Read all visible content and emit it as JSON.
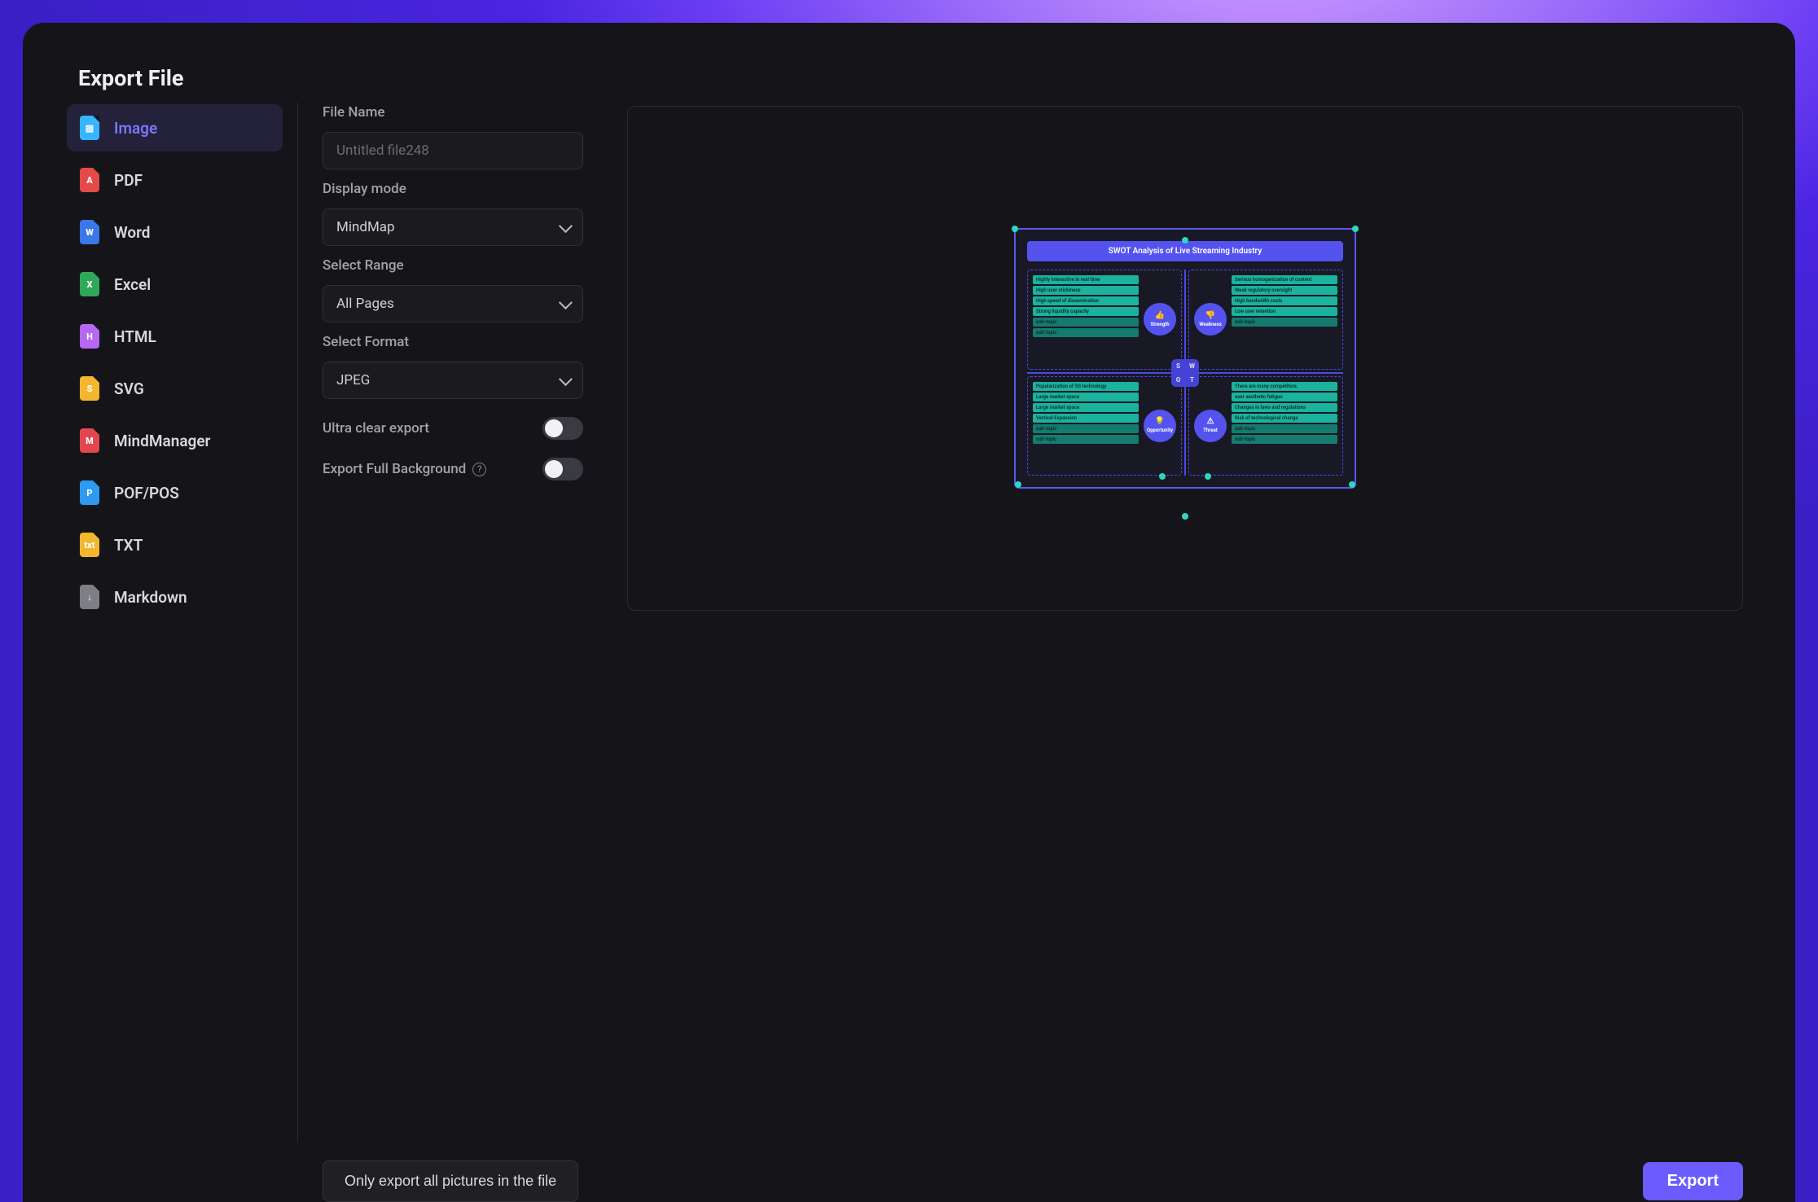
{
  "title": "Export File",
  "sidebar": [
    {
      "id": "image",
      "label": "Image",
      "glyph": "▨",
      "cls": "ic-img",
      "active": true
    },
    {
      "id": "pdf",
      "label": "PDF",
      "glyph": "A",
      "cls": "ic-pdf",
      "active": false
    },
    {
      "id": "word",
      "label": "Word",
      "glyph": "W",
      "cls": "ic-word",
      "active": false
    },
    {
      "id": "excel",
      "label": "Excel",
      "glyph": "X",
      "cls": "ic-xls",
      "active": false
    },
    {
      "id": "html",
      "label": "HTML",
      "glyph": "H",
      "cls": "ic-html",
      "active": false
    },
    {
      "id": "svg",
      "label": "SVG",
      "glyph": "S",
      "cls": "ic-svg",
      "active": false
    },
    {
      "id": "mindmanager",
      "label": "MindManager",
      "glyph": "M",
      "cls": "ic-mm",
      "active": false
    },
    {
      "id": "pofpos",
      "label": "POF/POS",
      "glyph": "P",
      "cls": "ic-pof",
      "active": false
    },
    {
      "id": "txt",
      "label": "TXT",
      "glyph": "txt",
      "cls": "ic-txt",
      "active": false
    },
    {
      "id": "markdown",
      "label": "Markdown",
      "glyph": "↓",
      "cls": "ic-md",
      "active": false
    }
  ],
  "form": {
    "filename_label": "File Name",
    "filename_placeholder": "Untitled file248",
    "filename_value": "",
    "display_mode_label": "Display mode",
    "display_mode_value": "MindMap",
    "select_range_label": "Select Range",
    "select_range_value": "All Pages",
    "select_format_label": "Select Format",
    "select_format_value": "JPEG",
    "ultra_clear_label": "Ultra clear export",
    "ultra_clear_on": false,
    "export_bg_label": "Export Full Background",
    "export_bg_on": false
  },
  "preview": {
    "title": "SWOT Analysis of Live Streaming Industry",
    "swot_letters": [
      "S",
      "W",
      "O",
      "T"
    ],
    "quadrants": {
      "strength": {
        "name": "Strength",
        "emoji": "👍",
        "items": [
          "Highly interactive in real time",
          "High user stickiness",
          "High speed of dissemination",
          "Strong liquidity capacity",
          "sub-topic",
          "sub-topic"
        ]
      },
      "weakness": {
        "name": "Weakness",
        "emoji": "👎",
        "items": [
          "Serious homogenization of content",
          "Weak regulatory oversight",
          "High bandwidth costs",
          "Low user retention",
          "sub-topic"
        ]
      },
      "opportunity": {
        "name": "Opportunity",
        "emoji": "💡",
        "items": [
          "Popularization of 5G technology",
          "Large market space",
          "Large market space",
          "Vertical Expansion",
          "sub-topic",
          "sub-topic"
        ]
      },
      "threat": {
        "name": "Threat",
        "emoji": "⚠",
        "items": [
          "There are many competitors.",
          "user aesthetic fatigue",
          "Changes in laws and regulations",
          "Risk of technological change",
          "sub-topic",
          "sub-topic"
        ]
      }
    }
  },
  "footer": {
    "secondary": "Only export all pictures in the file",
    "primary": "Export"
  },
  "colors": {
    "accent": "#6a5cff",
    "panel": "#151519",
    "teal": "#1bb29e"
  }
}
